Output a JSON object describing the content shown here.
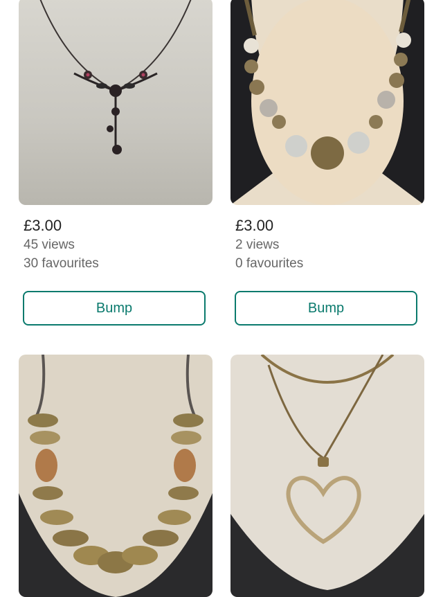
{
  "listings": [
    {
      "price": "£3.00",
      "views": "45 views",
      "favourites": "30 favourites",
      "bump_label": "Bump"
    },
    {
      "price": "£3.00",
      "views": "2 views",
      "favourites": "0 favourites",
      "bump_label": "Bump"
    }
  ],
  "colors": {
    "accent": "#0a7a6d",
    "secondary_text": "#666666",
    "primary_text": "#222222"
  }
}
